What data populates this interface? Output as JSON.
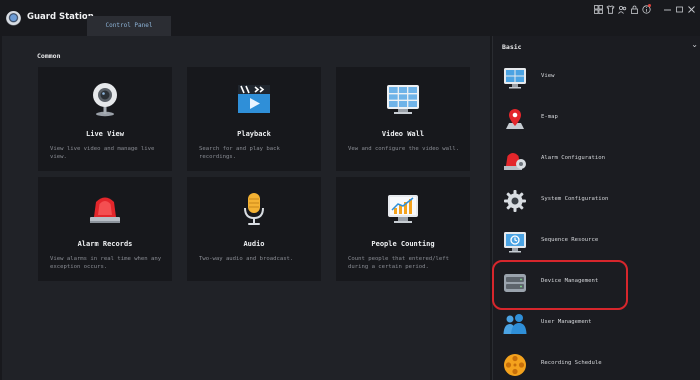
{
  "app": {
    "title": "Guard Station",
    "logo_icon": "guard-station-logo-icon"
  },
  "tabs": [
    {
      "label": "Control Panel"
    }
  ],
  "window_controls": [
    "layout-icon",
    "shirt-icon",
    "user-icon",
    "lock-icon",
    "info-icon",
    "minimize-icon",
    "restore-icon",
    "close-icon"
  ],
  "common": {
    "title": "Common",
    "tiles": [
      {
        "title": "Live View",
        "desc": "View live video and manage live view.",
        "icon": "camera-icon"
      },
      {
        "title": "Playback",
        "desc": "Search for and play back recordings.",
        "icon": "playback-icon"
      },
      {
        "title": "Video Wall",
        "desc": "Vew and configure the video wall.",
        "icon": "video-wall-icon"
      },
      {
        "title": "Alarm Records",
        "desc": "View alarms in real time when any exception occurs.",
        "icon": "alarm-light-icon"
      },
      {
        "title": "Audio",
        "desc": "Two-way audio and broadcast.",
        "icon": "microphone-icon"
      },
      {
        "title": "People Counting",
        "desc": "Count people that entered/left during a certain period.",
        "icon": "chart-monitor-icon"
      }
    ]
  },
  "basic": {
    "title": "Basic",
    "items": [
      {
        "label": "View",
        "icon": "monitor-icon"
      },
      {
        "label": "E-map",
        "icon": "map-pin-icon"
      },
      {
        "label": "Alarm Configuration",
        "icon": "alarm-config-icon"
      },
      {
        "label": "System Configuration",
        "icon": "gear-icon"
      },
      {
        "label": "Sequence Resource",
        "icon": "sequence-icon"
      },
      {
        "label": "Device Management",
        "icon": "server-icon"
      },
      {
        "label": "User Management",
        "icon": "users-icon"
      },
      {
        "label": "Recording Schedule",
        "icon": "film-reel-icon"
      }
    ]
  },
  "colors": {
    "accent": "#2f8fd8",
    "highlight": "#d7262c",
    "tile_bg": "#17181c",
    "panel_bg": "#202227"
  }
}
